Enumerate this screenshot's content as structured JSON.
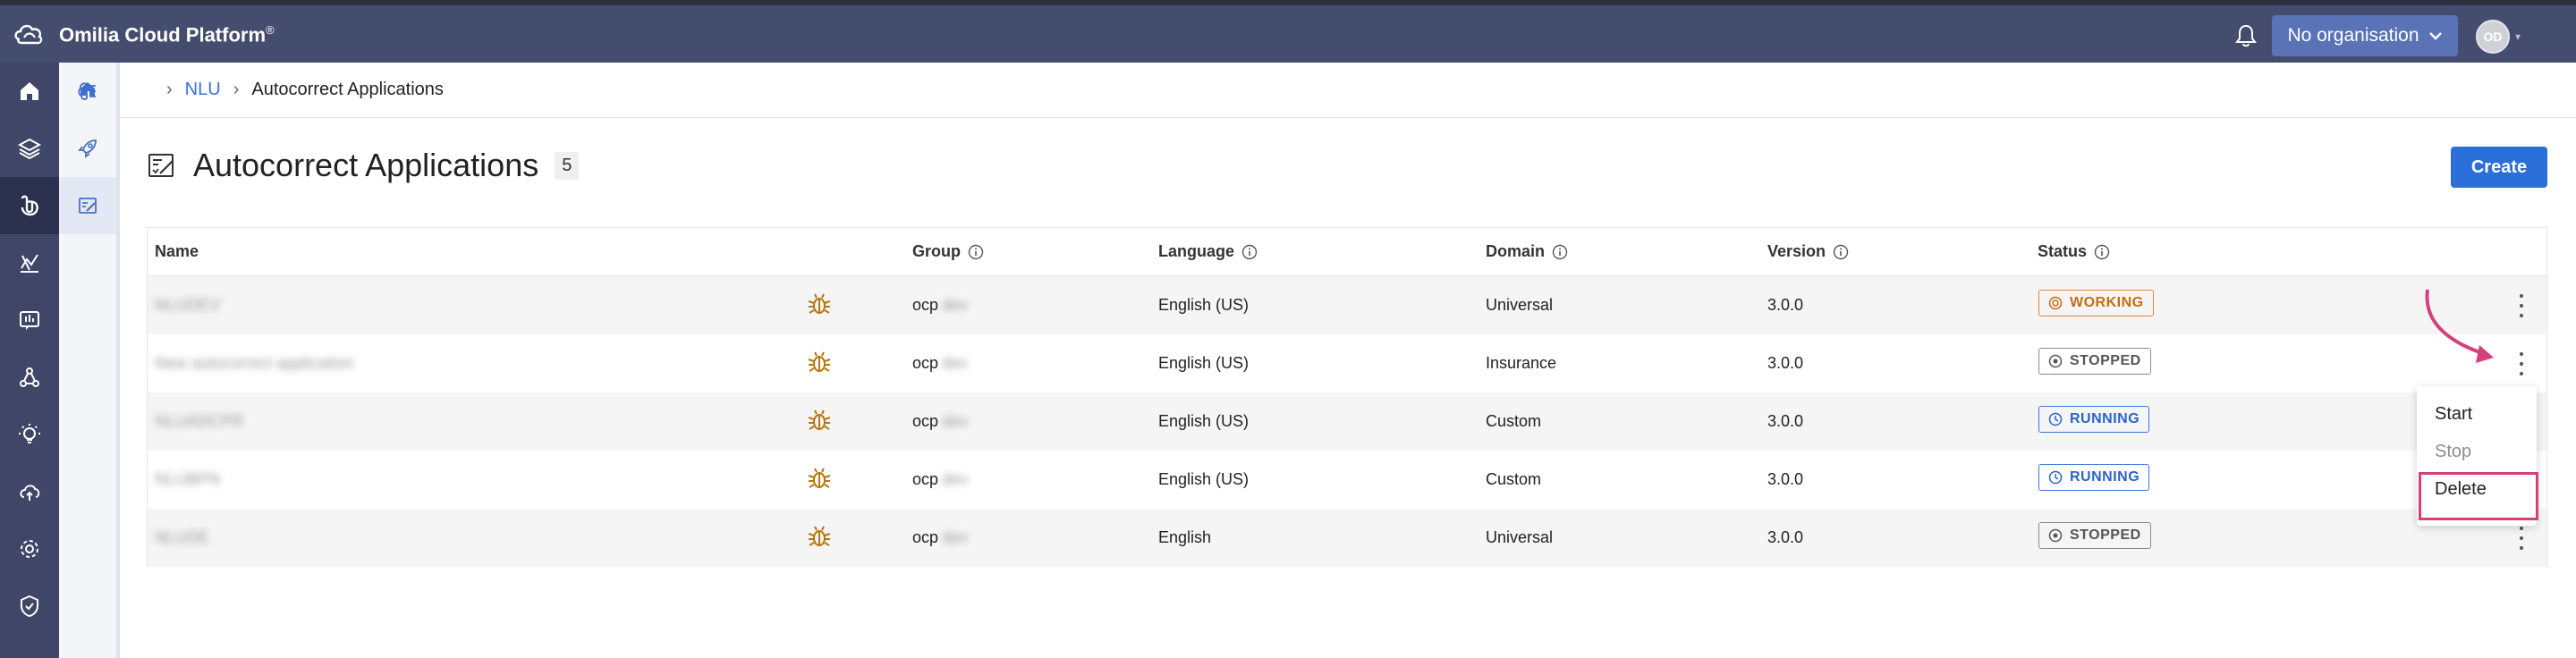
{
  "app": {
    "name": "Omilia Cloud Platform",
    "trademark": "®"
  },
  "header": {
    "org_button": "No organisation",
    "avatar_initials": "OD"
  },
  "nav_icons": [
    "home-icon",
    "layers-icon",
    "nlu-icon",
    "analytics-icon",
    "reports-icon",
    "flows-icon",
    "insights-icon",
    "cloud-icon",
    "settings-icon",
    "security-icon"
  ],
  "breadcrumb": {
    "items": [
      "NLU",
      "Autocorrect Applications"
    ]
  },
  "page": {
    "title": "Autocorrect Applications",
    "count": "5",
    "create_button": "Create"
  },
  "table": {
    "headers": [
      "Name",
      "Group",
      "Language",
      "Domain",
      "Version",
      "Status"
    ],
    "rows": [
      {
        "name": "NLUDEV",
        "group": "ocp",
        "group_suffix": "dev",
        "language": "English (US)",
        "domain": "Universal",
        "version": "3.0.0",
        "status": "WORKING"
      },
      {
        "name": "New autocorrect application",
        "group": "ocp",
        "group_suffix": "dev",
        "language": "English (US)",
        "domain": "Insurance",
        "version": "3.0.0",
        "status": "STOPPED"
      },
      {
        "name": "NLUADCPR",
        "group": "ocp",
        "group_suffix": "dev",
        "language": "English (US)",
        "domain": "Custom",
        "version": "3.0.0",
        "status": "RUNNING"
      },
      {
        "name": "NLUBPN",
        "group": "ocp",
        "group_suffix": "dev",
        "language": "English (US)",
        "domain": "Custom",
        "version": "3.0.0",
        "status": "RUNNING"
      },
      {
        "name": "NLUDE",
        "group": "ocp",
        "group_suffix": "dev",
        "language": "English",
        "domain": "Universal",
        "version": "3.0.0",
        "status": "STOPPED"
      }
    ]
  },
  "context_menu": {
    "items": [
      "Start",
      "Stop",
      "Delete"
    ]
  },
  "colors": {
    "topbar": "#454d6e",
    "leftnav": "#3f4668",
    "accent": "#2a6ed8",
    "working": "#c46d15",
    "running": "#2a64c9",
    "stopped": "#555555",
    "highlight": "#d6407a"
  }
}
